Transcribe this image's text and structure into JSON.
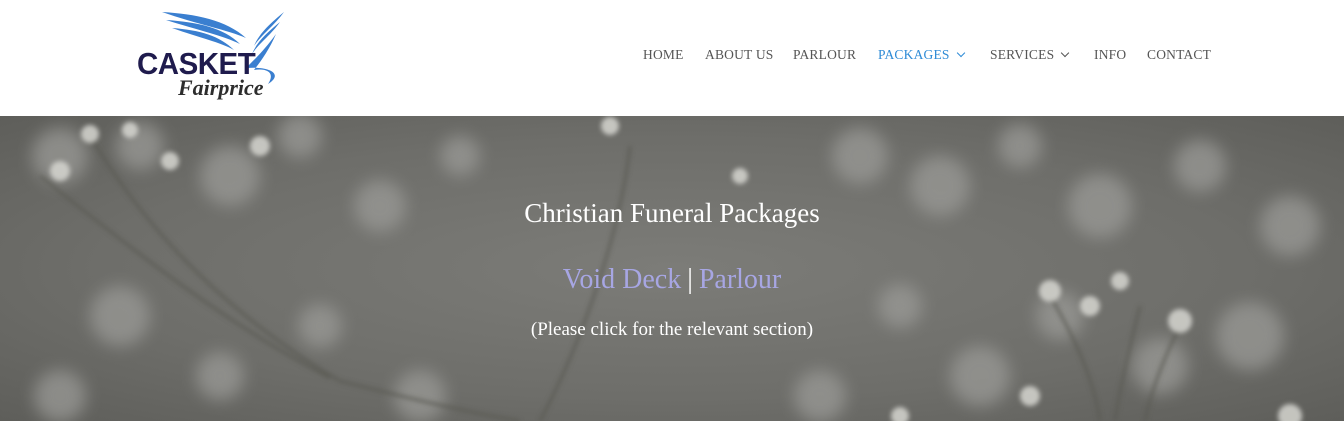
{
  "logo": {
    "brand": "CASKET",
    "sub": "Fairprice"
  },
  "nav": {
    "items": [
      {
        "label": "HOME"
      },
      {
        "label": "ABOUT US"
      },
      {
        "label": "PARLOUR"
      },
      {
        "label": "PACKAGES"
      },
      {
        "label": "SERVICES"
      },
      {
        "label": "INFO"
      },
      {
        "label": "CONTACT"
      }
    ],
    "active_color": "#2e8bd6"
  },
  "hero": {
    "title": "Christian Funeral Packages",
    "link1": "Void Deck",
    "separator": "|",
    "link2": "Parlour",
    "note": "(Please click for the relevant section)",
    "link_color": "#a7a6e3"
  }
}
